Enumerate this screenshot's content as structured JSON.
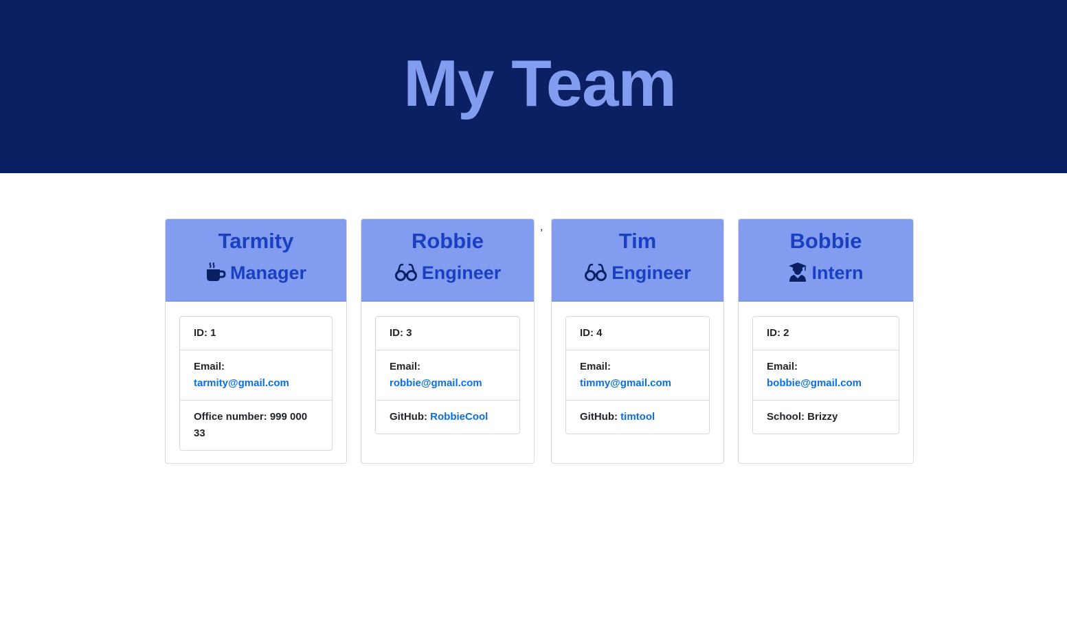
{
  "page": {
    "title": "My Team",
    "stray_char": ","
  },
  "colors": {
    "banner_bg": "#0b2063",
    "title": "#829df0",
    "card_header_bg": "#829df0",
    "card_header_text": "#1a3fc0",
    "link": "#0b6fe0"
  },
  "team": [
    {
      "name": "Tarmity",
      "role": "Manager",
      "role_icon": "coffee-mug-icon",
      "id_label": "ID: 1",
      "email_label": "Email:",
      "email": "tarmity@gmail.com",
      "extra_label": "Office number: 999 000 33",
      "extra_value": ""
    },
    {
      "name": "Robbie",
      "role": "Engineer",
      "role_icon": "glasses-icon",
      "id_label": "ID: 3",
      "email_label": "Email:",
      "email": "robbie@gmail.com",
      "extra_label": "GitHub: ",
      "extra_value": "RobbieCool"
    },
    {
      "name": "Tim",
      "role": "Engineer",
      "role_icon": "glasses-icon",
      "id_label": "ID: 4",
      "email_label": "Email:",
      "email": "timmy@gmail.com",
      "extra_label": "GitHub: ",
      "extra_value": "timtool"
    },
    {
      "name": "Bobbie",
      "role": "Intern",
      "role_icon": "graduate-icon",
      "id_label": "ID: 2",
      "email_label": "Email:",
      "email": "bobbie@gmail.com",
      "extra_label": "School: Brizzy",
      "extra_value": ""
    }
  ]
}
